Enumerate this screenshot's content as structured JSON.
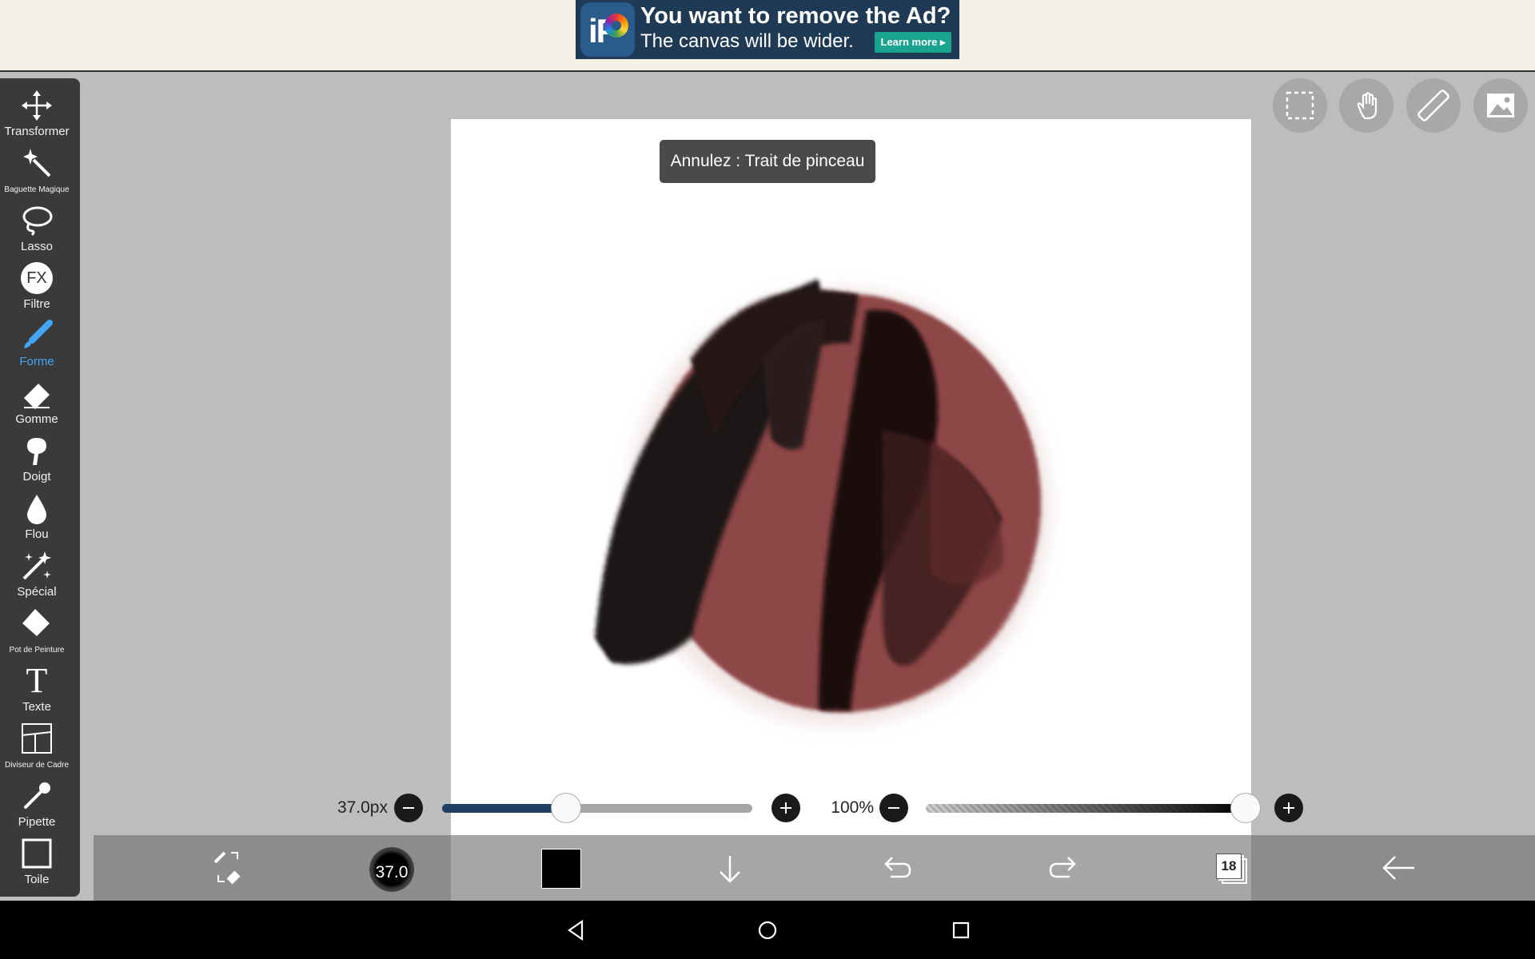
{
  "ad": {
    "title": "You want to remove the Ad?",
    "subtitle": "The canvas will be wider.",
    "button": "Learn more",
    "logo_text": "iP"
  },
  "toolbar": {
    "items": [
      {
        "label": "Transformer",
        "icon": "move-arrows-icon"
      },
      {
        "label": "Baguette Magique",
        "icon": "magic-wand-icon"
      },
      {
        "label": "Lasso",
        "icon": "lasso-icon"
      },
      {
        "label": "Filtre",
        "icon": "fx-icon",
        "icon_text": "FX"
      },
      {
        "label": "Forme",
        "icon": "brush-icon",
        "active": true
      },
      {
        "label": "Gomme",
        "icon": "eraser-icon"
      },
      {
        "label": "Doigt",
        "icon": "finger-smudge-icon"
      },
      {
        "label": "Flou",
        "icon": "blur-drop-icon"
      },
      {
        "label": "Spécial",
        "icon": "special-sparkle-icon"
      },
      {
        "label": "Pot de Peinture",
        "icon": "paint-bucket-icon"
      },
      {
        "label": "Texte",
        "icon": "text-icon",
        "icon_text": "T"
      },
      {
        "label": "Diviseur de Cadre",
        "icon": "frame-divider-icon"
      },
      {
        "label": "Pipette",
        "icon": "eyedropper-icon"
      },
      {
        "label": "Toile",
        "icon": "canvas-icon"
      }
    ]
  },
  "top_tools": [
    "selection-icon",
    "hand-icon",
    "ruler-icon",
    "reference-image-icon"
  ],
  "toast": "Annulez : Trait de pinceau",
  "brush_size": {
    "value_label": "37.0px",
    "fraction": 0.4
  },
  "opacity": {
    "value_label": "100%",
    "fraction": 1.0
  },
  "bottom_bar": {
    "brush_size_label": "37.0",
    "color": "#000000",
    "layer_count": "18"
  },
  "colors": {
    "accent": "#42a5f5",
    "toolbar_bg": "#3a3a3a",
    "slider_fill": "#1f3f63",
    "stroke_red": "#8b3a3a",
    "stroke_dark": "#1a1010"
  }
}
